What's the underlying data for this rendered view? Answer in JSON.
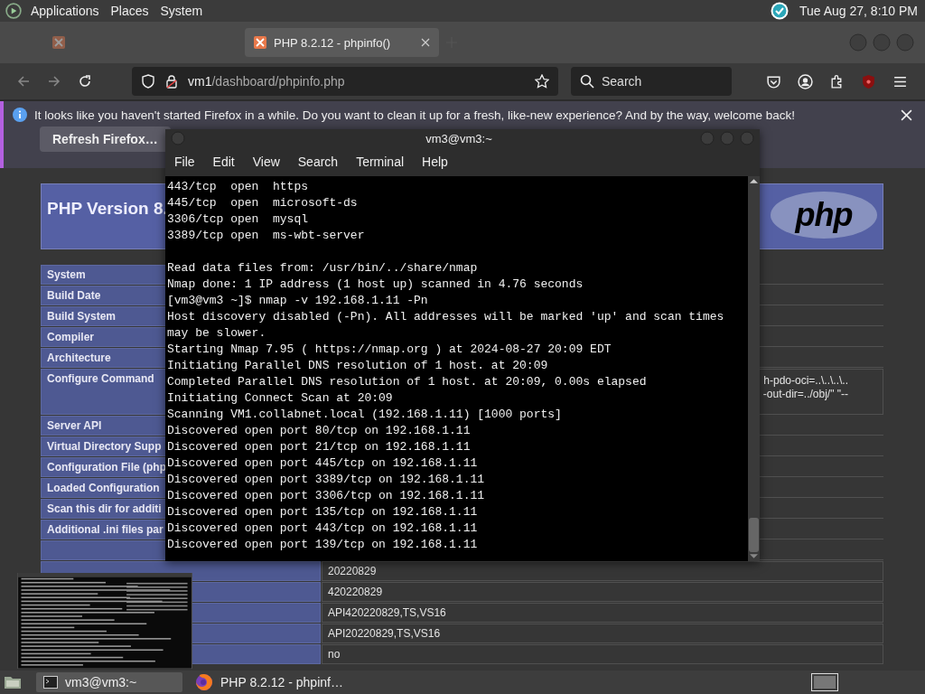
{
  "top_panel": {
    "menus": [
      "Applications",
      "Places",
      "System"
    ],
    "clock": "Tue Aug 27,  8:10 PM"
  },
  "browser": {
    "tabs": [
      {
        "selected": false
      },
      {
        "title": "PHP 8.2.12 - phpinfo()",
        "selected": true
      }
    ],
    "address": {
      "host": "vm1",
      "path": "/dashboard/phpinfo.php"
    },
    "search": {
      "placeholder": "Search"
    },
    "notification": {
      "message": "It looks like you haven't started Firefox in a while. Do you want to clean it up for a fresh, like-new experience? And by the way, welcome back!",
      "button": "Refresh Firefox…"
    },
    "phpinfo": {
      "title": "PHP Version 8.",
      "logo_text": "php",
      "rows": [
        {
          "label": "System"
        },
        {
          "label": "Build Date"
        },
        {
          "label": "Build System"
        },
        {
          "label": "Compiler"
        },
        {
          "label": "Architecture"
        },
        {
          "label": "Configure Command",
          "value_lines": [
            "h-pdo-oci=..\\..\\..\\..",
            "-out-dir=../obj/\" \"--"
          ]
        },
        {
          "label": "Server API"
        },
        {
          "label": "Virtual Directory Supp"
        },
        {
          "label": "Configuration File (php"
        },
        {
          "label": "Loaded Configuration"
        },
        {
          "label": "Scan this dir for additi"
        },
        {
          "label": "Additional .ini files par"
        },
        {},
        {
          "value": "20220829"
        },
        {
          "value": "420220829"
        },
        {
          "value": "API420220829,TS,VS16"
        },
        {
          "value": "API20220829,TS,VS16"
        },
        {
          "value": "no"
        }
      ]
    }
  },
  "terminal": {
    "title": "vm3@vm3:~",
    "menus": [
      "File",
      "Edit",
      "View",
      "Search",
      "Terminal",
      "Help"
    ],
    "lines": [
      "443/tcp  open  https",
      "445/tcp  open  microsoft-ds",
      "3306/tcp open  mysql",
      "3389/tcp open  ms-wbt-server",
      {
        "text": "Read data files from: /usr/bin/../share/nmap",
        "gap_before": true
      },
      "Nmap done: 1 IP address (1 host up) scanned in 4.76 seconds",
      "[vm3@vm3 ~]$ nmap -v 192.168.1.11 -Pn",
      "Host discovery disabled (-Pn). All addresses will be marked 'up' and scan times may be slower.",
      "Starting Nmap 7.95 ( https://nmap.org ) at 2024-08-27 20:09 EDT",
      "Initiating Parallel DNS resolution of 1 host. at 20:09",
      "Completed Parallel DNS resolution of 1 host. at 20:09, 0.00s elapsed",
      "Initiating Connect Scan at 20:09",
      "Scanning VM1.collabnet.local (192.168.1.11) [1000 ports]",
      "Discovered open port 80/tcp on 192.168.1.11",
      "Discovered open port 21/tcp on 192.168.1.11",
      "Discovered open port 445/tcp on 192.168.1.11",
      "Discovered open port 3389/tcp on 192.168.1.11",
      "Discovered open port 3306/tcp on 192.168.1.11",
      "Discovered open port 135/tcp on 192.168.1.11",
      "Discovered open port 443/tcp on 192.168.1.11",
      "Discovered open port 139/tcp on 192.168.1.11"
    ]
  },
  "taskbar": {
    "tasks": [
      {
        "kind": "terminal",
        "label": "vm3@vm3:~",
        "selected": true
      },
      {
        "kind": "browser",
        "label": "PHP 8.2.12 - phpinf…",
        "selected": false
      }
    ]
  }
}
